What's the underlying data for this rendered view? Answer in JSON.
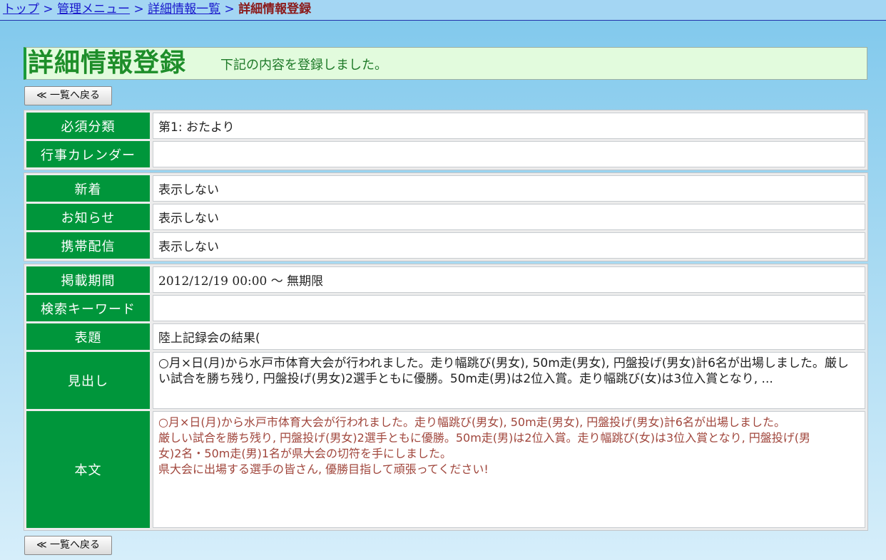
{
  "breadcrumb": {
    "items": [
      "トップ",
      "管理メニュー",
      "詳細情報一覧"
    ],
    "separator": ">",
    "current": "詳細情報登録"
  },
  "header": {
    "title": "詳細情報登録",
    "message": "下記の内容を登録しました。"
  },
  "buttons": {
    "back_label": "≪ 一覧へ戻る"
  },
  "fields": {
    "required_category": {
      "label": "必須分類",
      "value": "第1: おたより"
    },
    "event_calendar": {
      "label": "行事カレンダー",
      "value": ""
    },
    "new_arrivals": {
      "label": "新着",
      "value": "表示しない"
    },
    "notice": {
      "label": "お知らせ",
      "value": "表示しない"
    },
    "mobile": {
      "label": "携帯配信",
      "value": "表示しない"
    },
    "period": {
      "label": "掲載期間",
      "value": "2012/12/19 00:00 〜 無期限"
    },
    "keyword": {
      "label": "検索キーワード",
      "value": ""
    },
    "headline": {
      "label": "表題",
      "value": "陸上記録会の結果("
    },
    "summary": {
      "label": "見出し",
      "value": "○月×日(月)から水戸市体育大会が行われました。走り幅跳び(男女), 50m走(男女), 円盤投げ(男女)計6名が出場しました。厳しい試合を勝ち残り, 円盤投げ(男女)2選手ともに優勝。50m走(男)は2位入賞。走り幅跳び(女)は3位入賞となり, ..."
    },
    "body": {
      "label": "本文",
      "lines": [
        "○月×日(月)から水戸市体育大会が行われました。走り幅跳び(男女), 50m走(男女), 円盤投げ(男女)計6名が出場しました。",
        "厳しい試合を勝ち残り, 円盤投げ(男女)2選手ともに優勝。50m走(男)は2位入賞。走り幅跳び(女)は3位入賞となり, 円盤投げ(男",
        "女)2名・50m走(男)1名が県大会の切符を手にしました。",
        "県大会に出場する選手の皆さん, 優勝目指して頑張ってください!"
      ]
    }
  },
  "colors": {
    "label_bg": "#00963b",
    "title_text": "#1e8e2a",
    "title_bg": "#e2fbdd",
    "body_text": "#a0463c",
    "link": "#1a1acc",
    "current_crumb": "#8b1a1a"
  }
}
